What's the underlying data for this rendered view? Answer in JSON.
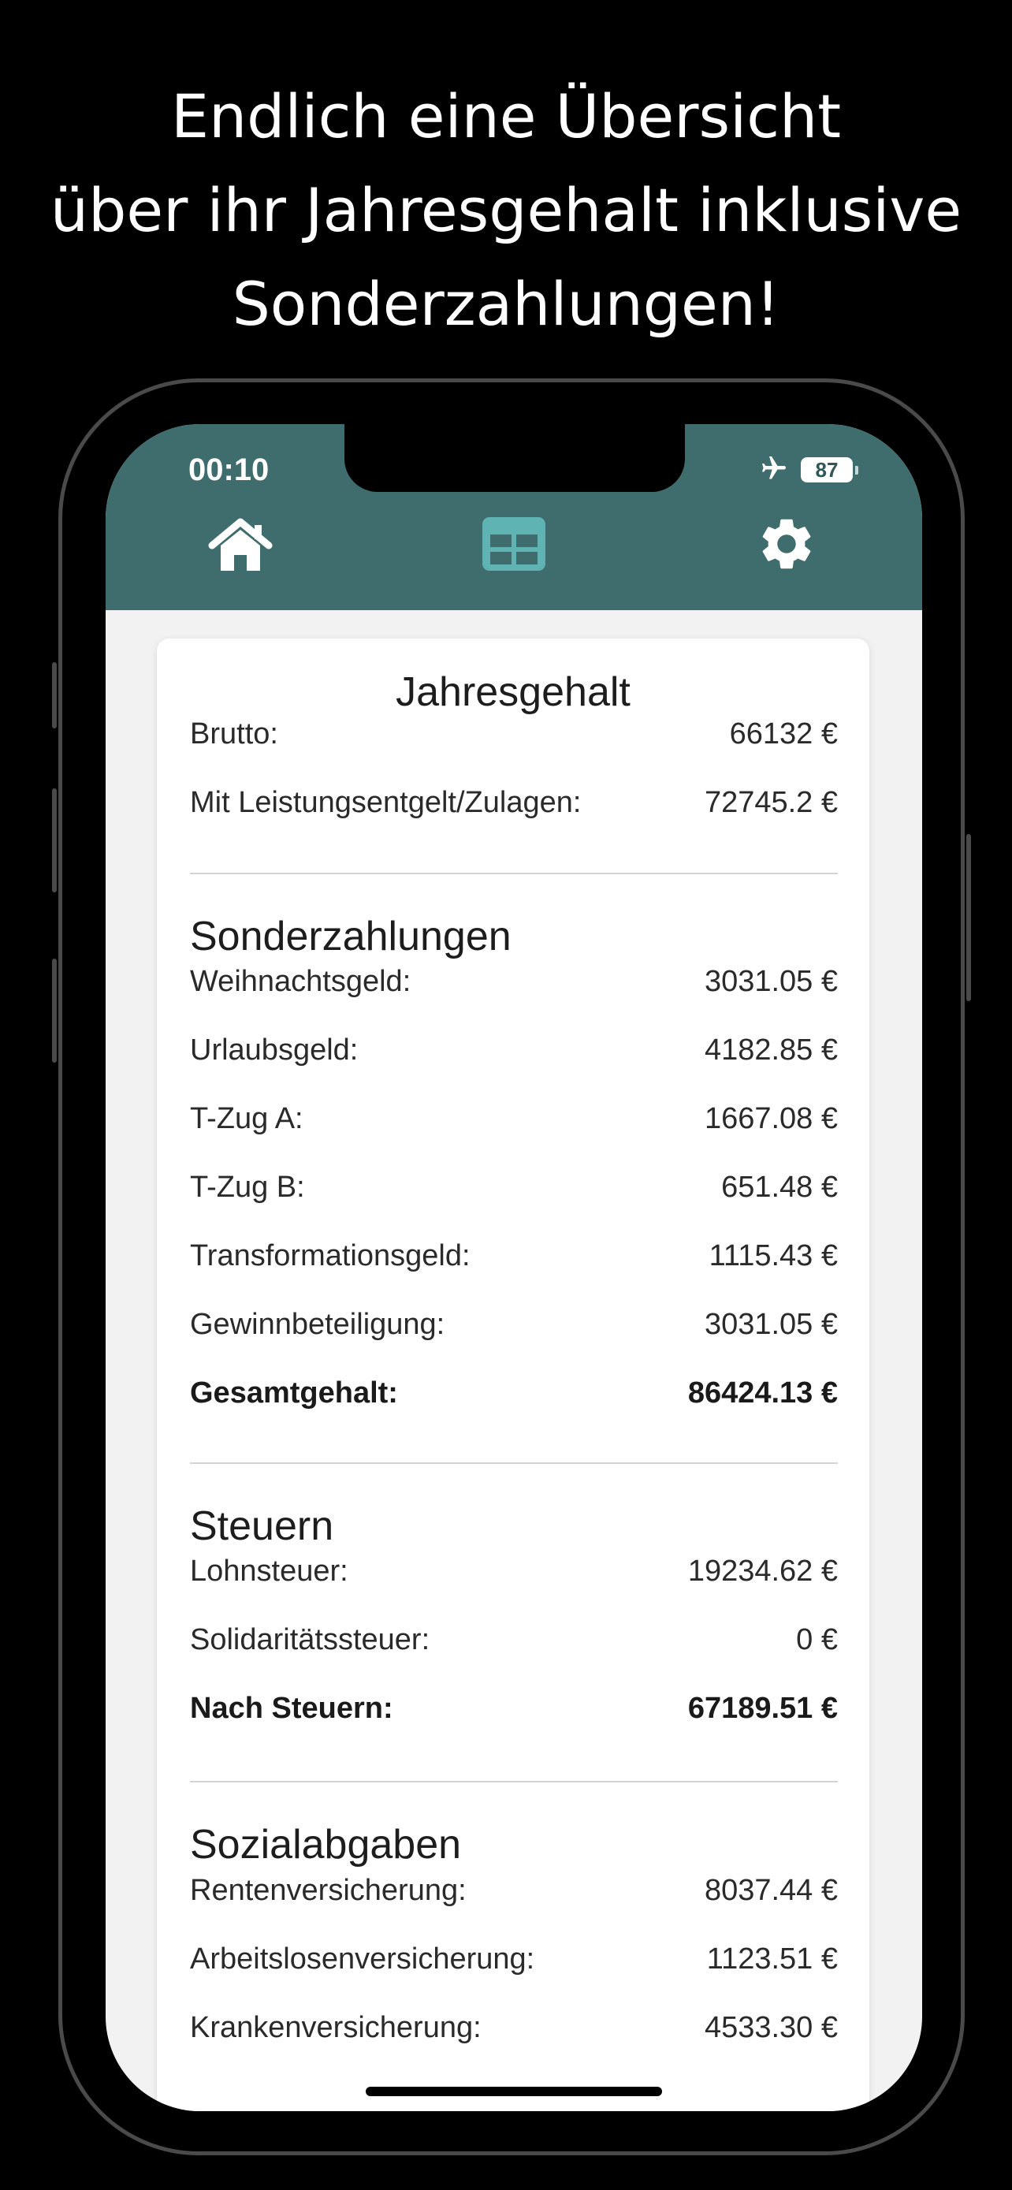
{
  "headline": {
    "line1": "Endlich eine Übersicht",
    "line2": "über ihr Jahresgehalt inklusive",
    "line3": "Sonderzahlungen!"
  },
  "status_bar": {
    "time": "00:10",
    "battery": "87"
  },
  "tabs": [
    {
      "icon": "home-icon"
    },
    {
      "icon": "table-icon"
    },
    {
      "icon": "gear-icon"
    }
  ],
  "card": {
    "title": "Jahresgehalt",
    "brutto": {
      "label": "Brutto:",
      "value": "66132 €"
    },
    "leistung": {
      "label": "Mit Leistungsentgelt/Zulagen:",
      "value": "72745.2 €"
    },
    "sonder": {
      "title": "Sonderzahlungen",
      "rows": [
        {
          "label": "Weihnachtsgeld:",
          "value": "3031.05 €"
        },
        {
          "label": "Urlaubsgeld:",
          "value": "4182.85 €"
        },
        {
          "label": "T-Zug A:",
          "value": "1667.08 €"
        },
        {
          "label": "T-Zug B:",
          "value": "651.48 €"
        },
        {
          "label": "Transformationsgeld:",
          "value": "1115.43 €"
        },
        {
          "label": "Gewinnbeteiligung:",
          "value": "3031.05 €"
        }
      ],
      "total": {
        "label": "Gesamtgehalt:",
        "value": "86424.13 €"
      }
    },
    "steuern": {
      "title": "Steuern",
      "rows": [
        {
          "label": "Lohnsteuer:",
          "value": "19234.62 €"
        },
        {
          "label": "Solidaritätssteuer:",
          "value": "0 €"
        }
      ],
      "total": {
        "label": "Nach Steuern:",
        "value": "67189.51 €"
      }
    },
    "sozial": {
      "title": "Sozialabgaben",
      "rows": [
        {
          "label": "Rentenversicherung:",
          "value": "8037.44 €"
        },
        {
          "label": "Arbeitslosenversicherung:",
          "value": "1123.51 €"
        },
        {
          "label": "Krankenversicherung:",
          "value": "4533.30 €"
        }
      ]
    }
  },
  "colors": {
    "header": "#3f6d6d",
    "active_tab": "#5fb3b3"
  }
}
